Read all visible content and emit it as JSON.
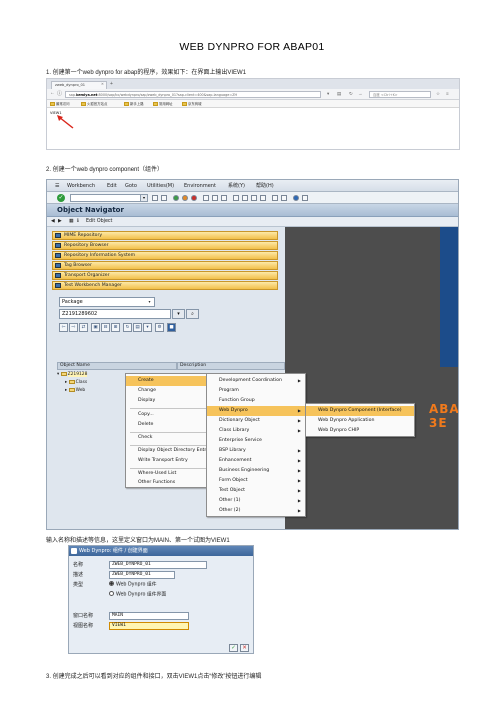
{
  "doc": {
    "title": "WEB DYNPRO FOR ABAP01",
    "step1": "1. 创建第一个web dynpro for abap的程序，效果如下：在界面上输出VIEW1",
    "step2": "2. 创建一个web dynpro component（组件）",
    "step2b": "输入名称和描述等信息，这里定义窗口为MAIN、第一个试图为VIEW1",
    "step3": "3. 创建完成之后可以看到对应的组件和接口，双击VIEW1点击“修改”按钮进行编辑"
  },
  "browser": {
    "tab_title": "zweb_dynpro_01",
    "url_prefix": "sap.",
    "url_host": "kemiya.net",
    "url_rest": ":8000/sap/bc/webdynpro/sap/zweb_dynpro_01?sap-client=400&sap-language=ZH",
    "search_placeholder": "百度 <Ctrl+K>",
    "bookmarks": [
      "最常访问",
      "火狐官方站点",
      "新手上路",
      "常用网址",
      "京东商城"
    ],
    "page_text": "VIEW1"
  },
  "sap": {
    "menu": [
      "Workbench",
      "Edit",
      "Goto",
      "Utilities(M)",
      "Environment",
      "系统(Y)",
      "帮助(H)"
    ],
    "screen_title": "Object Navigator",
    "edit_object": "Edit Object",
    "nav_buttons": [
      "MIME Repository",
      "Repository Browser",
      "Repository Information System",
      "Tag Browser",
      "Transport Organizer",
      "Test Workbench Manager"
    ],
    "object_type": "Package",
    "object_name": "Z2191289602",
    "col_object_name": "Object Name",
    "col_description": "Description",
    "tree": [
      "Z219128",
      "Class",
      "Web"
    ],
    "context_menu": [
      "Create",
      "Change",
      "Display",
      "Copy...",
      "Delete",
      "Check",
      "Display Object Directory Entry",
      "Write Transport Entry",
      "Where-Used List",
      "Other Functions"
    ],
    "create_submenu": [
      "Development Coordination",
      "Program",
      "Function Group",
      "Web Dynpro",
      "Dictionary Object",
      "Class Library",
      "Enterprise Service",
      "BSP Library",
      "Enhancement",
      "Business Engineering",
      "Form Object",
      "Test Object",
      "Other (1)",
      "Other (2)"
    ],
    "webdynpro_submenu": [
      "Web Dynpro Component (Interface)",
      "Web Dynpro Application",
      "Web Dynpro CHIP"
    ],
    "background_text": "ABAP DE",
    "background_text2": "3E"
  },
  "dialog": {
    "title": "Web Dynpro: 组件 / 创建界面",
    "name_label": "名称",
    "name_value": "ZWEB_DYNPRO_01",
    "desc_label": "描述",
    "desc_value": "ZWEB_DYNPRO_01",
    "type_label": "类型",
    "radio1": "Web Dynpro 组件",
    "radio2": "Web Dynpro 组件界面",
    "window_label": "窗口名称",
    "window_value": "MAIN",
    "view_label": "视图名称",
    "view_value": "VIEW1"
  }
}
